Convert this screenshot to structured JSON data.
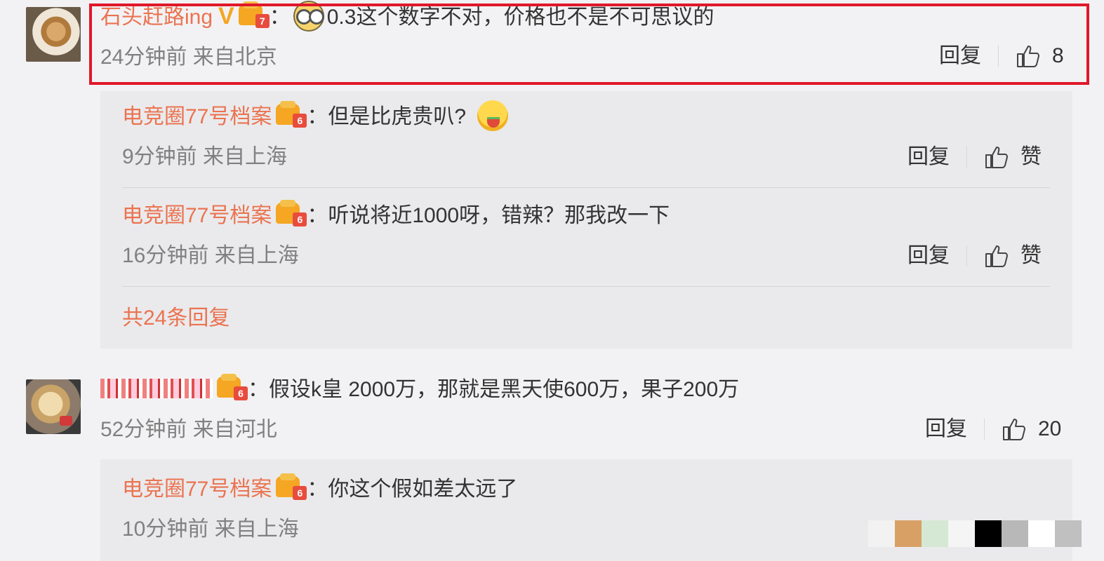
{
  "comments": [
    {
      "username": "石头赶路ing",
      "level": "7",
      "text": "0.3这个数字不对，价格也不是不可思议的",
      "time": "24分钟前",
      "location": "来自北京",
      "reply_label": "回复",
      "like_count": "8"
    },
    {
      "username": "",
      "level": "6",
      "text": "假设k皇 2000万，那就是黑天使600万，果子200万",
      "time": "52分钟前",
      "location": "来自河北",
      "reply_label": "回复",
      "like_count": "20"
    }
  ],
  "replies_block_1": {
    "items": [
      {
        "username": "电竞圈77号档案",
        "level": "6",
        "text": "但是比虎贵叭?",
        "time": "9分钟前",
        "location": "来自上海",
        "reply_label": "回复",
        "like_label": "赞"
      },
      {
        "username": "电竞圈77号档案",
        "level": "6",
        "text": "听说将近1000呀，错辣？那我改一下",
        "time": "16分钟前",
        "location": "来自上海",
        "reply_label": "回复",
        "like_label": "赞"
      }
    ],
    "more_label": "共24条回复"
  },
  "replies_block_2": {
    "items": [
      {
        "username": "电竞圈77号档案",
        "level": "6",
        "text": "你这个假如差太远了",
        "time": "10分钟前",
        "location": "来自上海"
      }
    ]
  },
  "colon": "：",
  "icons": {
    "verified": "verified-v-icon",
    "level_badge": "crown-level-badge-icon",
    "thumb": "thumbs-up-icon",
    "emoji_glasses": "glasses-emoji-icon",
    "emoji_melon": "eating-melon-emoji-icon"
  },
  "colors": {
    "username": "#eb7350",
    "highlight_border": "#e0182a",
    "meta_text": "#808080",
    "page_background": "#f2f2f4",
    "reply_background": "#eaeaec"
  },
  "swatches": [
    "#f2f2f2",
    "#d9a066",
    "#d5e8d4",
    "#f5f5f5",
    "#000000",
    "#b8b8b8",
    "#ffffff",
    "#c0c0c0"
  ]
}
